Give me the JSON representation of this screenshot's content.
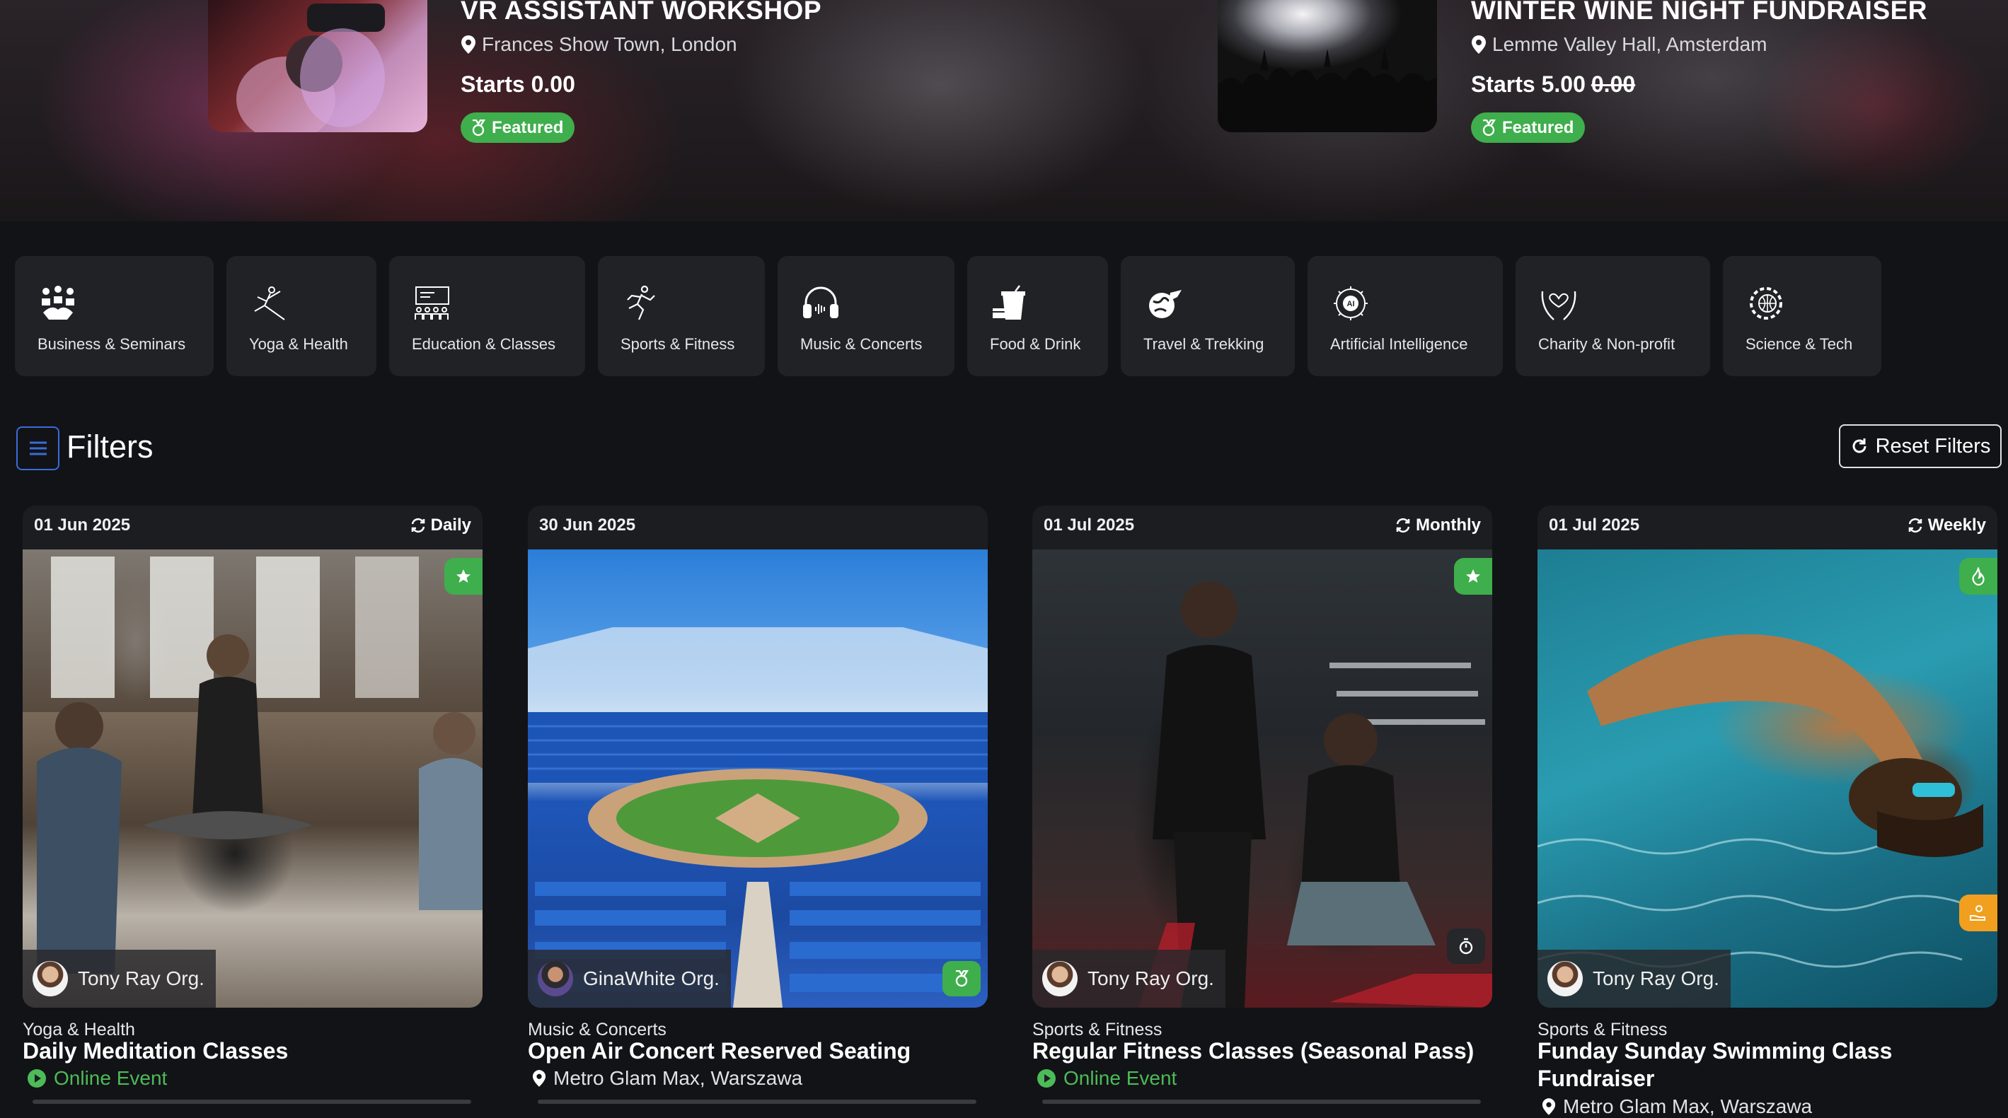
{
  "hero": {
    "events": [
      {
        "title": "VR ASSISTANT WORKSHOP",
        "location": "Frances Show Town, London",
        "price": "Starts 0.00",
        "old_price": "",
        "badge": "Featured"
      },
      {
        "title": "WINTER WINE NIGHT FUNDRAISER",
        "location": "Lemme Valley Hall, Amsterdam",
        "price": "Starts 5.00",
        "old_price": "0.00",
        "badge": "Featured"
      }
    ]
  },
  "categories": [
    {
      "label": "Business & Seminars",
      "icon": "handshake-people-icon"
    },
    {
      "label": "Yoga & Health",
      "icon": "yoga-pose-icon"
    },
    {
      "label": "Education & Classes",
      "icon": "classroom-board-icon"
    },
    {
      "label": "Sports & Fitness",
      "icon": "running-person-icon"
    },
    {
      "label": "Music & Concerts",
      "icon": "headphones-icon"
    },
    {
      "label": "Food & Drink",
      "icon": "fastfood-icon"
    },
    {
      "label": "Travel & Trekking",
      "icon": "globe-plane-icon"
    },
    {
      "label": "Artificial Intelligence",
      "icon": "ai-chip-icon"
    },
    {
      "label": "Charity & Non-profit",
      "icon": "heart-hands-icon"
    },
    {
      "label": "Science & Tech",
      "icon": "globe-gear-icon"
    }
  ],
  "filters": {
    "title": "Filters",
    "reset_label": "Reset Filters"
  },
  "events": [
    {
      "date": "01 Jun 2025",
      "recurrence": "Daily",
      "organizer": "Tony Ray Org.",
      "category": "Yoga & Health",
      "title": "Daily Meditation Classes",
      "meta": "Online Event",
      "meta_type": "online"
    },
    {
      "date": "30 Jun 2025",
      "recurrence": "",
      "organizer": "GinaWhite Org.",
      "category": "Music & Concerts",
      "title": "Open Air Concert Reserved Seating",
      "meta": "Metro Glam Max, Warszawa",
      "meta_type": "location"
    },
    {
      "date": "01 Jul 2025",
      "recurrence": "Monthly",
      "organizer": "Tony Ray Org.",
      "category": "Sports & Fitness",
      "title": "Regular Fitness Classes (Seasonal Pass)",
      "meta": "Online Event",
      "meta_type": "online"
    },
    {
      "date": "01 Jul 2025",
      "recurrence": "Weekly",
      "organizer": "Tony Ray Org.",
      "category": "Sports & Fitness",
      "title": "Funday Sunday Swimming Class Fundraiser",
      "meta": "Metro Glam Max, Warszawa",
      "meta_type": "location"
    }
  ],
  "colors": {
    "accent_green": "#3fae4c",
    "online_green": "#4cbb58",
    "filter_blue": "#3b6bd9",
    "hot_orange": "#f0a01e"
  }
}
